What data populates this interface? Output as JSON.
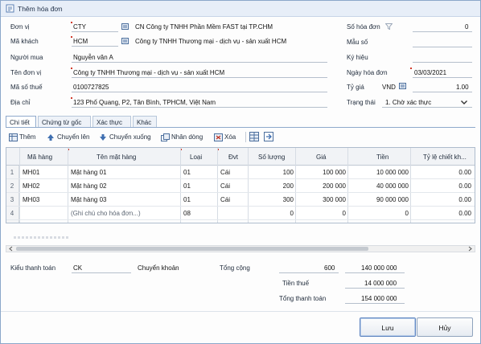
{
  "window": {
    "title": "Thêm hóa đơn"
  },
  "form": {
    "don_vi": {
      "label": "Đơn vị",
      "code": "CTY",
      "name": "CN Công ty TNHH Phần Mềm FAST tại TP.CHM"
    },
    "ma_khach": {
      "label": "Mã khách",
      "code": "HCM",
      "name": "Công ty TNHH Thương mại - dịch vụ - sản xuất HCM"
    },
    "nguoi_mua": {
      "label": "Người mua",
      "value": "Nguyễn văn A"
    },
    "ten_don_vi": {
      "label": "Tên đơn vị",
      "value": "Công ty TNHH Thương mại - dịch vụ - sản xuất HCM"
    },
    "ma_so_thue": {
      "label": "Mã số thuế",
      "value": "0100727825"
    },
    "dia_chi": {
      "label": "Địa chỉ",
      "value": "123 Phố Quang, P2, Tân Bình, TPHCM, Việt Nam"
    },
    "so_hoa_don": {
      "label": "Số hóa đơn",
      "value": "0"
    },
    "mau_so": {
      "label": "Mẫu số",
      "value": ""
    },
    "ky_hieu": {
      "label": "Ký hiệu",
      "value": ""
    },
    "ngay_hoa_don": {
      "label": "Ngày hóa đơn",
      "value": "03/03/2021"
    },
    "ty_gia": {
      "label": "Tỷ giá",
      "currency": "VND",
      "value": "1.00"
    },
    "trang_thai": {
      "label": "Trạng thái",
      "value": "1. Chờ xác thực"
    }
  },
  "tabs": [
    "Chi tiết",
    "Chứng từ gốc",
    "Xác thực",
    "Khác"
  ],
  "toolbar": {
    "add": "Thêm",
    "move_up": "Chuyển lên",
    "move_down": "Chuyển xuống",
    "copy_row": "Nhân dòng",
    "delete": "Xóa"
  },
  "grid": {
    "columns": [
      "Mã hàng",
      "Tên mặt hàng",
      "Loại",
      "Đvt",
      "Số lượng",
      "Giá",
      "Tiền",
      "Tỷ lệ chiết kh..."
    ],
    "rows": [
      {
        "num": "1",
        "ma": "MH01",
        "ten": "Mặt hàng 01",
        "loai": "01",
        "dvt": "Cái",
        "sl": "100",
        "gia": "100 000",
        "tien": "10 000 000",
        "ck": "0.00"
      },
      {
        "num": "2",
        "ma": "MH02",
        "ten": "Mặt hàng 02",
        "loai": "01",
        "dvt": "Cái",
        "sl": "200",
        "gia": "200 000",
        "tien": "40 000 000",
        "ck": "0.00"
      },
      {
        "num": "3",
        "ma": "MH03",
        "ten": "Mặt hàng 03",
        "loai": "01",
        "dvt": "Cái",
        "sl": "300",
        "gia": "300 000",
        "tien": "90 000 000",
        "ck": "0.00"
      },
      {
        "num": "4",
        "ma": "",
        "ten": "(Ghi chú cho hóa đơn...)",
        "loai": "08",
        "dvt": "",
        "sl": "0",
        "gia": "0",
        "tien": "0",
        "ck": "0.00"
      }
    ]
  },
  "summary": {
    "kieu_thanh_toan": {
      "label": "Kiểu thanh toán",
      "code": "CK",
      "name": "Chuyển khoản"
    },
    "tong_cong": {
      "label": "Tổng cộng",
      "qty": "600",
      "value": "140 000 000"
    },
    "tien_thue": {
      "label": "Tiền thuế",
      "value": "14 000 000"
    },
    "tong_thanh_toan": {
      "label": "Tổng thanh toán",
      "value": "154 000 000"
    }
  },
  "buttons": {
    "save": "Lưu",
    "cancel": "Hủy"
  },
  "colors": {
    "title_bar": "#e7eef8",
    "border": "#8ba7c9",
    "required_mark": "#d23a2a",
    "link_blue": "#2a5ca8"
  }
}
